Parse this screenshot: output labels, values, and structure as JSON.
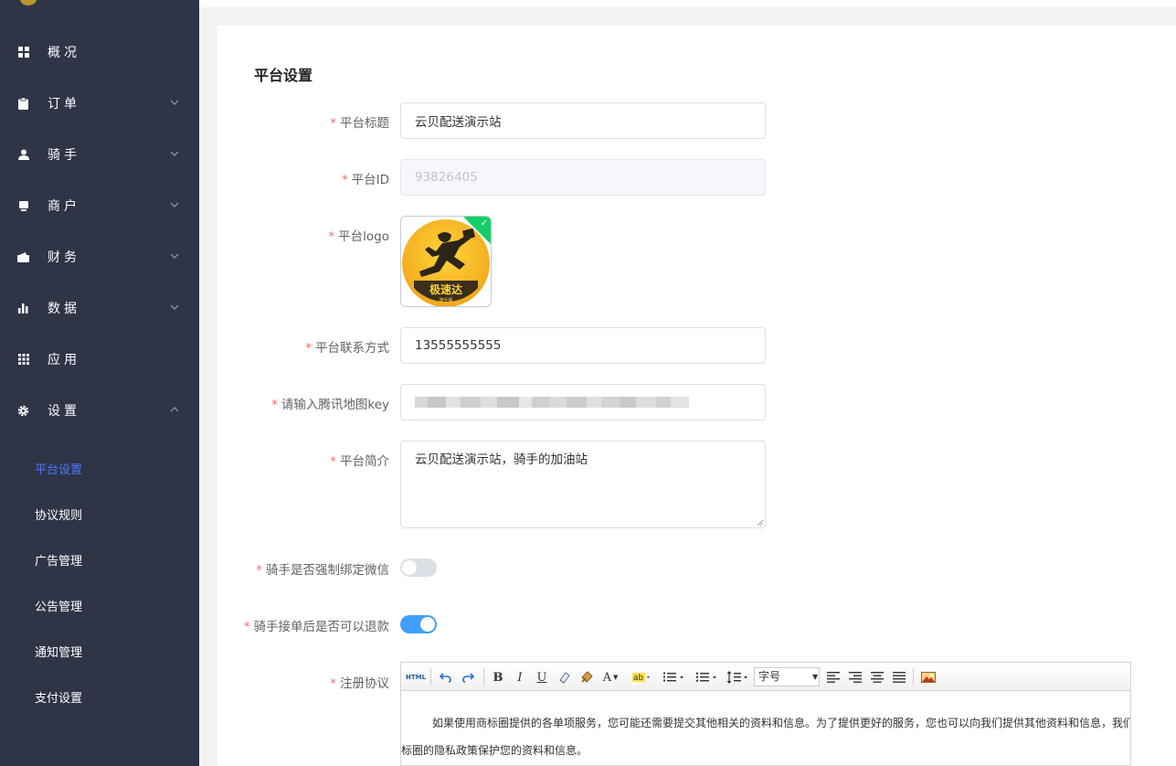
{
  "sidebar": {
    "items": [
      {
        "label": "概况",
        "icon": "dashboard-grid-icon"
      },
      {
        "label": "订单",
        "icon": "clipboard-icon"
      },
      {
        "label": "骑手",
        "icon": "user-icon"
      },
      {
        "label": "商户",
        "icon": "store-icon"
      },
      {
        "label": "财务",
        "icon": "wallet-icon"
      },
      {
        "label": "数据",
        "icon": "bar-chart-icon"
      },
      {
        "label": "应用",
        "icon": "apps-grid-icon"
      },
      {
        "label": "设置",
        "icon": "gear-icon"
      }
    ],
    "sub_items": [
      {
        "label": "平台设置",
        "active": true
      },
      {
        "label": "协议规则"
      },
      {
        "label": "广告管理"
      },
      {
        "label": "公告管理"
      },
      {
        "label": "通知管理"
      },
      {
        "label": "支付设置"
      }
    ]
  },
  "form": {
    "section_title": "平台设置",
    "title_label": "平台标题",
    "title_value": "云贝配送演示站",
    "id_label": "平台ID",
    "id_value": "93826405",
    "logo_label": "平台logo",
    "logo_text": "极速达",
    "logo_subtext": "骑手版",
    "contact_label": "平台联系方式",
    "contact_value": "13555555555",
    "mapkey_label": "请输入腾讯地图key",
    "intro_label": "平台简介",
    "intro_value": "云贝配送演示站，骑手的加油站",
    "bind_wechat_label": "骑手是否强制绑定微信",
    "bind_wechat_on": false,
    "refund_label": "骑手接单后是否可以退款",
    "refund_on": true,
    "agreement_label": "注册协议"
  },
  "editor": {
    "toolbar": {
      "html": "HTML",
      "bold": "B",
      "italic": "I",
      "underline": "U",
      "font_color": "A",
      "font_size_placeholder": "字号"
    },
    "body_line1": "如果使用商标圈提供的各单项服务，您可能还需要提交其他相关的资料和信息。为了提供更好的服务，您也可以向我们提供其他资料和信息，我们",
    "body_line2": "标圈的隐私政策保护您的资料和信息。"
  },
  "colors": {
    "sidebar_bg": "#2f3447",
    "active_blue": "#4a77ff",
    "switch_on": "#409eff",
    "switch_off": "#dcdfe6",
    "required": "#f56c6c",
    "success": "#13ce66"
  }
}
